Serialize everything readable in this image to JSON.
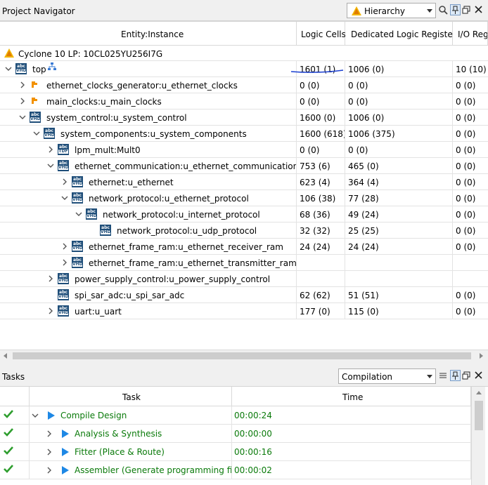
{
  "navigator": {
    "title": "Project Navigator",
    "view_selector": "Hierarchy",
    "device": "Cyclone 10 LP: 10CL025YU256I7G",
    "columns": {
      "entity": "Entity:Instance",
      "logic_cells": "Logic Cells",
      "registers": "Dedicated Logic Registers",
      "io": "I/O Reg"
    },
    "rows": [
      {
        "name": "top",
        "logic": "1601 (1)",
        "regs": "1006 (0)",
        "io": "10 (10)"
      },
      {
        "name": "ethernet_clocks_generator:u_ethernet_clocks",
        "logic": "0 (0)",
        "regs": "0 (0)",
        "io": "0 (0)"
      },
      {
        "name": "main_clocks:u_main_clocks",
        "logic": "0 (0)",
        "regs": "0 (0)",
        "io": "0 (0)"
      },
      {
        "name": "system_control:u_system_control",
        "logic": "1600 (0)",
        "regs": "1006 (0)",
        "io": "0 (0)"
      },
      {
        "name": "system_components:u_system_components",
        "logic": "1600 (618)",
        "regs": "1006 (375)",
        "io": "0 (0)"
      },
      {
        "name": "lpm_mult:Mult0",
        "logic": "0 (0)",
        "regs": "0 (0)",
        "io": "0 (0)"
      },
      {
        "name": "ethernet_communication:u_ethernet_communication",
        "logic": "753 (6)",
        "regs": "465 (0)",
        "io": "0 (0)"
      },
      {
        "name": "ethernet:u_ethernet",
        "logic": "623 (4)",
        "regs": "364 (4)",
        "io": "0 (0)"
      },
      {
        "name": "network_protocol:u_ethernet_protocol",
        "logic": "106 (38)",
        "regs": "77 (28)",
        "io": "0 (0)"
      },
      {
        "name": "network_protocol:u_internet_protocol",
        "logic": "68 (36)",
        "regs": "49 (24)",
        "io": "0 (0)"
      },
      {
        "name": "network_protocol:u_udp_protocol",
        "logic": "32 (32)",
        "regs": "25 (25)",
        "io": "0 (0)"
      },
      {
        "name": "ethernet_frame_ram:u_ethernet_receiver_ram",
        "logic": "24 (24)",
        "regs": "24 (24)",
        "io": "0 (0)"
      },
      {
        "name": "ethernet_frame_ram:u_ethernet_transmitter_ram",
        "logic": "",
        "regs": "",
        "io": ""
      },
      {
        "name": "power_supply_control:u_power_supply_control",
        "logic": "",
        "regs": "",
        "io": ""
      },
      {
        "name": "spi_sar_adc:u_spi_sar_adc",
        "logic": "62 (62)",
        "regs": "51 (51)",
        "io": "0 (0)"
      },
      {
        "name": "uart:u_uart",
        "logic": "177 (0)",
        "regs": "115 (0)",
        "io": "0 (0)"
      }
    ]
  },
  "tasks": {
    "title": "Tasks",
    "flow_selector": "Compilation",
    "columns": {
      "task": "Task",
      "time": "Time"
    },
    "rows": [
      {
        "name": "Compile Design",
        "time": "00:00:24"
      },
      {
        "name": "Analysis & Synthesis",
        "time": "00:00:00"
      },
      {
        "name": "Fitter (Place & Route)",
        "time": "00:00:16"
      },
      {
        "name": "Assembler (Generate programming files)",
        "time": "00:00:02"
      }
    ]
  },
  "colors": {
    "accent": "#1e88e5",
    "task_text": "#0a7a0a",
    "check": "#2e9e2e",
    "vhd_icon": "#1f4e79",
    "annotation": "#1a3fd1"
  }
}
